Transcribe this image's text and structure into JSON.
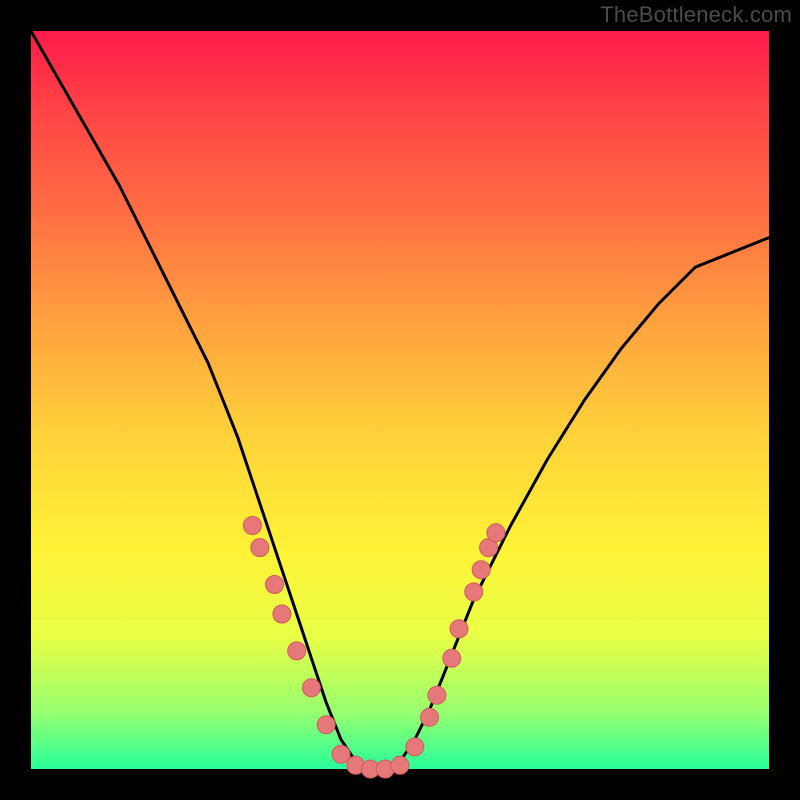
{
  "watermark": "TheBottleneck.com",
  "chart_data": {
    "type": "line",
    "title": "",
    "xlabel": "",
    "ylabel": "",
    "xlim": [
      0,
      100
    ],
    "ylim": [
      0,
      100
    ],
    "series": [
      {
        "name": "curve",
        "x": [
          0,
          4,
          8,
          12,
          16,
          20,
          24,
          26,
          28,
          30,
          32,
          34,
          36,
          38,
          40,
          42,
          44,
          46,
          48,
          50,
          52,
          54,
          56,
          58,
          60,
          65,
          70,
          75,
          80,
          85,
          90,
          95,
          100
        ],
        "y": [
          100,
          93,
          86,
          79,
          71,
          63,
          55,
          50,
          45,
          39,
          33,
          27,
          21,
          15,
          9,
          4,
          1,
          0,
          0,
          1,
          4,
          8,
          13,
          18,
          23,
          33,
          42,
          50,
          57,
          63,
          68,
          70,
          72
        ]
      }
    ],
    "markers": [
      {
        "x": 30,
        "y": 33
      },
      {
        "x": 31,
        "y": 30
      },
      {
        "x": 33,
        "y": 25
      },
      {
        "x": 34,
        "y": 21
      },
      {
        "x": 36,
        "y": 16
      },
      {
        "x": 38,
        "y": 11
      },
      {
        "x": 40,
        "y": 6
      },
      {
        "x": 42,
        "y": 2
      },
      {
        "x": 44,
        "y": 0.5
      },
      {
        "x": 46,
        "y": 0
      },
      {
        "x": 48,
        "y": 0
      },
      {
        "x": 50,
        "y": 0.5
      },
      {
        "x": 52,
        "y": 3
      },
      {
        "x": 54,
        "y": 7
      },
      {
        "x": 55,
        "y": 10
      },
      {
        "x": 57,
        "y": 15
      },
      {
        "x": 58,
        "y": 19
      },
      {
        "x": 60,
        "y": 24
      },
      {
        "x": 61,
        "y": 27
      },
      {
        "x": 62,
        "y": 30
      },
      {
        "x": 63,
        "y": 32
      }
    ],
    "colors": {
      "curve": "#000000",
      "marker_fill": "#e6787a",
      "marker_stroke": "#d15a5c"
    }
  }
}
